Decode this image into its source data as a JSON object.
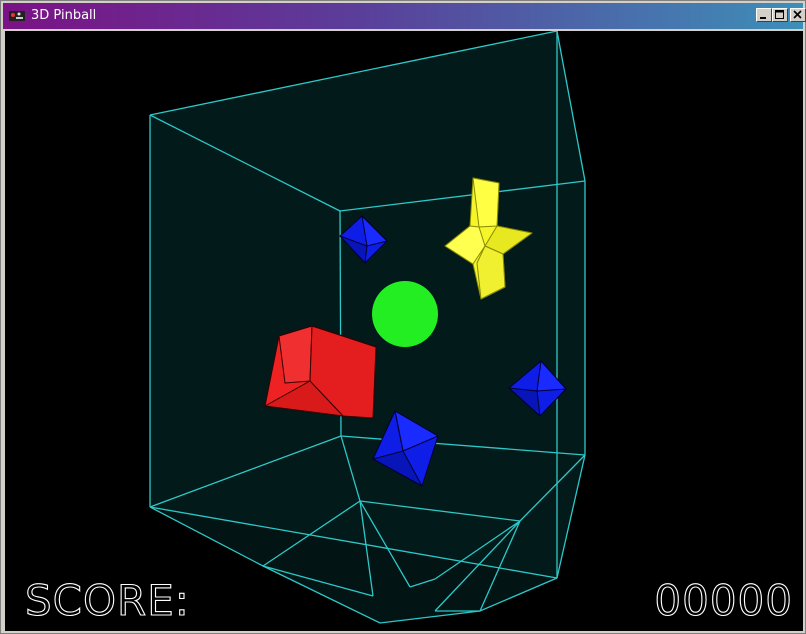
{
  "window": {
    "title": "3D Pinball",
    "icon": "pinball-app-icon",
    "controls": [
      "minimize",
      "maximize",
      "close"
    ]
  },
  "hud": {
    "score_label": "SCORE:",
    "score_value": "00000"
  },
  "scene": {
    "frame_color": "#2ec8c8",
    "background_color": "#031818",
    "objects": [
      {
        "name": "green-sphere",
        "color": "#22ee22"
      },
      {
        "name": "red-cube",
        "color": "#ee2222"
      },
      {
        "name": "yellow-star",
        "color": "#ffff22"
      },
      {
        "name": "blue-octahedron",
        "color": "#1122ee"
      }
    ]
  }
}
